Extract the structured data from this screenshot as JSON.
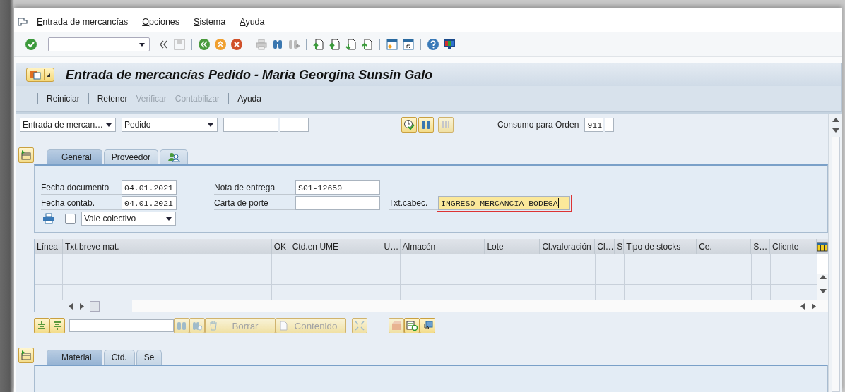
{
  "menu_bar": [
    "Entrada de mercancías",
    "Opciones",
    "Sistema",
    "Ayuda"
  ],
  "title": "Entrada de mercancías Pedido - Maria Georgina Sunsin Galo",
  "app_toolbar": [
    {
      "label": "Reiniciar",
      "disabled": false
    },
    {
      "label": "Retener",
      "disabled": false
    },
    {
      "label": "Verificar",
      "disabled": true
    },
    {
      "label": "Contabilizar",
      "disabled": true
    },
    {
      "label": "Ayuda",
      "disabled": false
    }
  ],
  "header": {
    "transaction": "Entrada de mercan…",
    "reference": "Pedido",
    "movement_label": "Consumo para Orden",
    "movement_type": "911"
  },
  "header_tabs": [
    {
      "kind": "text",
      "label": "General",
      "selected": true
    },
    {
      "kind": "text",
      "label": "Proveedor",
      "selected": false
    },
    {
      "kind": "icon",
      "selected": false
    }
  ],
  "general": {
    "document_date_label": "Fecha documento",
    "document_date": "04.01.2021",
    "posting_date_label": "Fecha contab.",
    "posting_date": "04.01.2021",
    "delivery_note_label": "Nota de entrega",
    "delivery_note": "S01-12650",
    "bill_of_lading_label": "Carta de porte",
    "header_text_label": "Txt.cabec.",
    "header_text": "INGRESO MERCANCIA BODEGA",
    "header_text_focused": true,
    "print_checked": false,
    "print_version": "Vale colectivo"
  },
  "table": {
    "columns": [
      "Línea",
      "Txt.breve mat.",
      "OK",
      "Ctd.en UME",
      "U…",
      "Almacén",
      "Lote",
      "Cl.valoración",
      "Cl…",
      "S",
      "Tipo de stocks",
      "Ce.",
      "S…",
      "Cliente"
    ]
  },
  "item_toolbar": [
    {
      "label": "Borrar",
      "disabled": true
    },
    {
      "label": "Contenido",
      "disabled": true
    }
  ],
  "detail_tabs": [
    {
      "label": "Material",
      "selected": true
    },
    {
      "label": "Ctd.",
      "selected": false
    },
    {
      "label": "Se",
      "selected": false
    }
  ]
}
